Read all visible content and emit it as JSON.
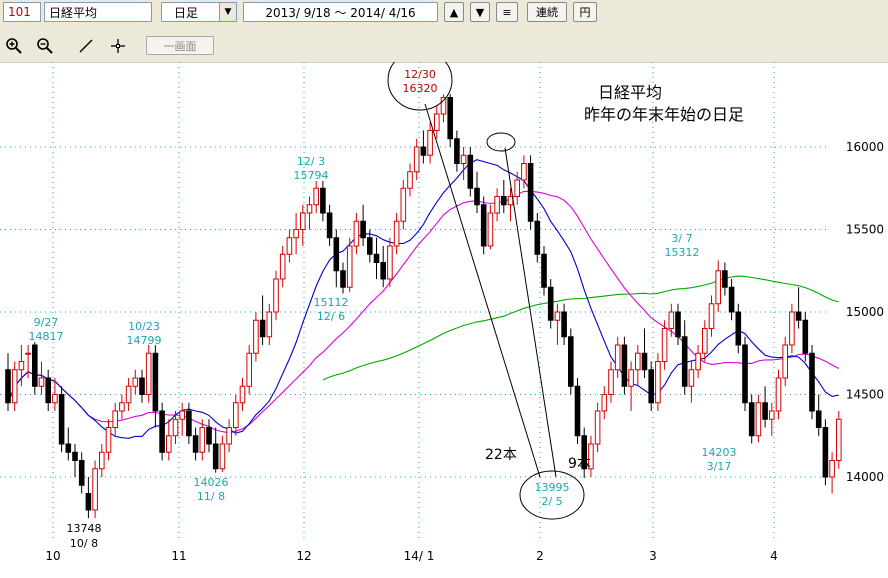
{
  "toolbar": {
    "code": "101",
    "name": "日経平均",
    "period": "日足",
    "dropdown_glyph": "▼",
    "range": "2013/ 9/18 ～ 2014/ 4/16",
    "up_glyph": "▲",
    "down_glyph": "▼",
    "menu_glyph": "≡",
    "continuous_label": "連続",
    "yen_label": "円",
    "zoom_in_icon": "zoom-in-icon",
    "zoom_out_icon": "zoom-out-icon",
    "line_icon": "line-tool-icon",
    "crosshair_icon": "crosshair-icon",
    "one_screen_label": "一画面"
  },
  "chart_data": {
    "type": "candlestick",
    "title": "日経平均",
    "subtitle": "昨年の年末年始の日足",
    "x_ticks": [
      "10",
      "11",
      "12",
      "14/ 1",
      "2",
      "3",
      "4"
    ],
    "y_ticks": [
      14000,
      14500,
      15000,
      15500,
      16000
    ],
    "ylim": [
      13700,
      16500
    ],
    "grid": true,
    "colors": {
      "up": "#d80000",
      "down": "#000000",
      "ma_short": "#0000cc",
      "ma_mid": "#dd00dd",
      "ma_long": "#00aa00",
      "annotation": "#19a8b0",
      "peak": "#c00000"
    },
    "annotations": [
      {
        "date": "9/27",
        "value": "14817"
      },
      {
        "date": "10/23",
        "value": "14799"
      },
      {
        "date": "12/ 3",
        "value": "15794"
      },
      {
        "date": "15112",
        "value": "12/ 6"
      },
      {
        "date": "12/30",
        "value": "16320"
      },
      {
        "date": "14026",
        "value": "11/ 8"
      },
      {
        "date": "3/ 7",
        "value": "15312"
      },
      {
        "date": "14203",
        "value": "3/17"
      },
      {
        "date": "13995",
        "value": "2/ 5"
      },
      {
        "date": "13748",
        "value": "10/ 8"
      }
    ],
    "notes": [
      "22本",
      "9本"
    ],
    "candles": [
      [
        14650,
        14750,
        14400,
        14450
      ],
      [
        14450,
        14700,
        14400,
        14650
      ],
      [
        14650,
        14800,
        14550,
        14700
      ],
      [
        14750,
        14800,
        14600,
        14750
      ],
      [
        14800,
        14817,
        14500,
        14550
      ],
      [
        14550,
        14700,
        14500,
        14600
      ],
      [
        14600,
        14650,
        14400,
        14450
      ],
      [
        14450,
        14600,
        14400,
        14500
      ],
      [
        14500,
        14550,
        14150,
        14200
      ],
      [
        14200,
        14300,
        14100,
        14150
      ],
      [
        14150,
        14200,
        14000,
        14100
      ],
      [
        14100,
        14150,
        13900,
        13950
      ],
      [
        13900,
        14000,
        13750,
        13800
      ],
      [
        13800,
        14100,
        13750,
        14050
      ],
      [
        14050,
        14200,
        14000,
        14150
      ],
      [
        14150,
        14350,
        14100,
        14300
      ],
      [
        14300,
        14450,
        14250,
        14400
      ],
      [
        14400,
        14500,
        14350,
        14450
      ],
      [
        14450,
        14600,
        14400,
        14550
      ],
      [
        14550,
        14650,
        14500,
        14600
      ],
      [
        14600,
        14650,
        14450,
        14500
      ],
      [
        14500,
        14800,
        14450,
        14750
      ],
      [
        14750,
        14799,
        14300,
        14400
      ],
      [
        14400,
        14450,
        14100,
        14150
      ],
      [
        14150,
        14350,
        14100,
        14250
      ],
      [
        14250,
        14400,
        14200,
        14350
      ],
      [
        14350,
        14450,
        14250,
        14400
      ],
      [
        14400,
        14450,
        14200,
        14250
      ],
      [
        14250,
        14300,
        14100,
        14150
      ],
      [
        14150,
        14350,
        14100,
        14300
      ],
      [
        14300,
        14350,
        14150,
        14200
      ],
      [
        14200,
        14300,
        14026,
        14050
      ],
      [
        14050,
        14250,
        14030,
        14200
      ],
      [
        14200,
        14350,
        14150,
        14300
      ],
      [
        14300,
        14500,
        14250,
        14450
      ],
      [
        14450,
        14600,
        14400,
        14550
      ],
      [
        14550,
        14800,
        14500,
        14750
      ],
      [
        14750,
        15000,
        14700,
        14950
      ],
      [
        14950,
        15100,
        14800,
        14850
      ],
      [
        14850,
        15050,
        14800,
        15000
      ],
      [
        15000,
        15250,
        14950,
        15200
      ],
      [
        15200,
        15400,
        15150,
        15350
      ],
      [
        15350,
        15500,
        15300,
        15450
      ],
      [
        15450,
        15600,
        15350,
        15500
      ],
      [
        15500,
        15650,
        15400,
        15600
      ],
      [
        15600,
        15700,
        15500,
        15650
      ],
      [
        15650,
        15794,
        15600,
        15750
      ],
      [
        15750,
        15794,
        15550,
        15600
      ],
      [
        15600,
        15650,
        15400,
        15450
      ],
      [
        15450,
        15500,
        15150,
        15250
      ],
      [
        15250,
        15300,
        15112,
        15150
      ],
      [
        15150,
        15450,
        15120,
        15400
      ],
      [
        15400,
        15600,
        15350,
        15550
      ],
      [
        15550,
        15650,
        15400,
        15450
      ],
      [
        15450,
        15500,
        15300,
        15350
      ],
      [
        15350,
        15450,
        15200,
        15300
      ],
      [
        15300,
        15400,
        15150,
        15200
      ],
      [
        15200,
        15450,
        15150,
        15400
      ],
      [
        15400,
        15600,
        15350,
        15550
      ],
      [
        15550,
        15800,
        15500,
        15750
      ],
      [
        15750,
        15900,
        15700,
        15850
      ],
      [
        15850,
        16050,
        15800,
        16000
      ],
      [
        16000,
        16100,
        15900,
        15950
      ],
      [
        15950,
        16150,
        15900,
        16100
      ],
      [
        16100,
        16250,
        16050,
        16200
      ],
      [
        16200,
        16320,
        16150,
        16300
      ],
      [
        16300,
        16320,
        16000,
        16050
      ],
      [
        16050,
        16100,
        15850,
        15900
      ],
      [
        15900,
        16000,
        15800,
        15950
      ],
      [
        15950,
        16000,
        15700,
        15750
      ],
      [
        15750,
        15850,
        15600,
        15650
      ],
      [
        15650,
        15700,
        15350,
        15400
      ],
      [
        15400,
        15650,
        15380,
        15600
      ],
      [
        15600,
        15750,
        15550,
        15700
      ],
      [
        15700,
        15800,
        15600,
        15650
      ],
      [
        15650,
        15750,
        15550,
        15700
      ],
      [
        15700,
        15850,
        15650,
        15800
      ],
      [
        15800,
        15950,
        15750,
        15900
      ],
      [
        15900,
        15950,
        15500,
        15550
      ],
      [
        15550,
        15600,
        15300,
        15350
      ],
      [
        15350,
        15400,
        15100,
        15150
      ],
      [
        15150,
        15200,
        14900,
        14950
      ],
      [
        14950,
        15050,
        14800,
        15000
      ],
      [
        15000,
        15050,
        14800,
        14850
      ],
      [
        14850,
        14900,
        14500,
        14550
      ],
      [
        14550,
        14600,
        14200,
        14250
      ],
      [
        14250,
        14300,
        13995,
        14050
      ],
      [
        14050,
        14250,
        14000,
        14200
      ],
      [
        14200,
        14450,
        14150,
        14400
      ],
      [
        14400,
        14550,
        14350,
        14500
      ],
      [
        14500,
        14700,
        14450,
        14650
      ],
      [
        14650,
        14850,
        14600,
        14800
      ],
      [
        14800,
        14850,
        14500,
        14550
      ],
      [
        14550,
        14700,
        14400,
        14650
      ],
      [
        14650,
        14800,
        14550,
        14750
      ],
      [
        14750,
        14900,
        14600,
        14650
      ],
      [
        14650,
        14700,
        14400,
        14450
      ],
      [
        14450,
        14750,
        14400,
        14700
      ],
      [
        14700,
        14950,
        14650,
        14900
      ],
      [
        14900,
        15050,
        14850,
        15000
      ],
      [
        15000,
        15050,
        14800,
        14850
      ],
      [
        14850,
        14950,
        14500,
        14550
      ],
      [
        14550,
        14700,
        14450,
        14650
      ],
      [
        14650,
        14800,
        14600,
        14750
      ],
      [
        14750,
        14950,
        14700,
        14900
      ],
      [
        14900,
        15100,
        14850,
        15050
      ],
      [
        15050,
        15312,
        15000,
        15250
      ],
      [
        15250,
        15300,
        15100,
        15150
      ],
      [
        15150,
        15200,
        14950,
        15000
      ],
      [
        15000,
        15050,
        14750,
        14800
      ],
      [
        14800,
        14850,
        14400,
        14450
      ],
      [
        14450,
        14500,
        14203,
        14250
      ],
      [
        14250,
        14500,
        14210,
        14450
      ],
      [
        14450,
        14550,
        14300,
        14350
      ],
      [
        14350,
        14450,
        14250,
        14400
      ],
      [
        14400,
        14650,
        14350,
        14600
      ],
      [
        14600,
        14850,
        14550,
        14800
      ],
      [
        14800,
        15050,
        14750,
        15000
      ],
      [
        15000,
        15150,
        14900,
        14950
      ],
      [
        14950,
        15000,
        14700,
        14750
      ],
      [
        14750,
        14800,
        14350,
        14400
      ],
      [
        14400,
        14500,
        14250,
        14300
      ],
      [
        14300,
        14350,
        13950,
        14000
      ],
      [
        14000,
        14150,
        13900,
        14100
      ],
      [
        14100,
        14400,
        14050,
        14350
      ]
    ]
  }
}
